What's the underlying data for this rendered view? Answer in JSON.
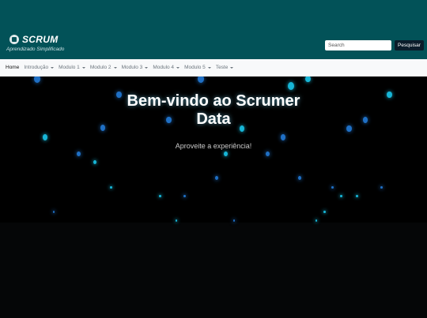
{
  "brand": {
    "name": "SCRUM",
    "tagline": "Aprendizado Simplificado",
    "icon": "book-icon"
  },
  "search": {
    "placeholder": "Search",
    "button_label": "Pesquisar"
  },
  "nav": {
    "items": [
      {
        "label": "Home",
        "dropdown": false,
        "active": true
      },
      {
        "label": "Introdução",
        "dropdown": true
      },
      {
        "label": "Modulo 1",
        "dropdown": true
      },
      {
        "label": "Modulo 2",
        "dropdown": true
      },
      {
        "label": "Modulo 3",
        "dropdown": true
      },
      {
        "label": "Modulo 4",
        "dropdown": true
      },
      {
        "label": "Modulo 5",
        "dropdown": true
      },
      {
        "label": "Teste",
        "dropdown": true
      }
    ]
  },
  "hero": {
    "title_line1": "Bem-vindo ao Scrumer",
    "title_line2": "Data",
    "subtitle": "Aproveite a experiência!"
  },
  "colors": {
    "header_bg": "#025258",
    "nav_bg": "#f8f9fa",
    "hero_bg": "#000000",
    "button_bg": "#0b1d2b",
    "particle": "#17b5d6"
  }
}
